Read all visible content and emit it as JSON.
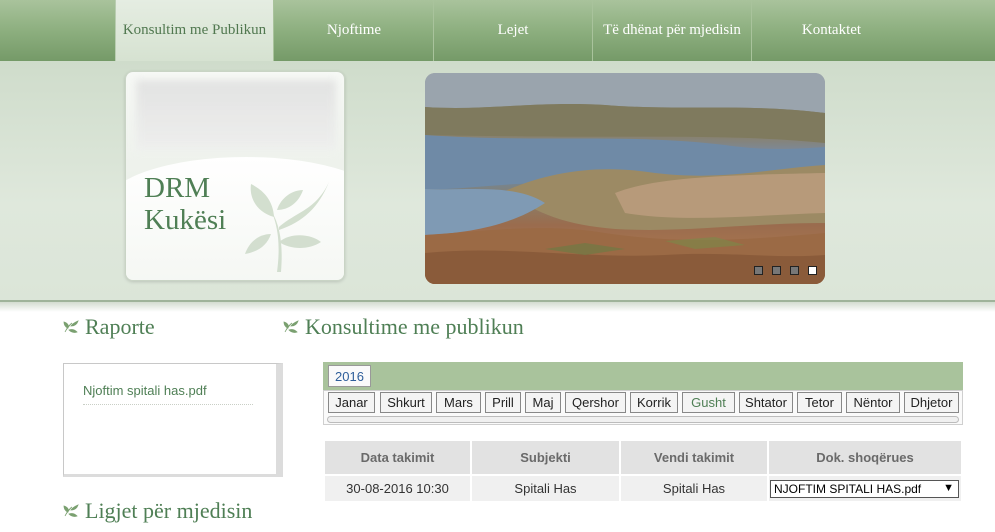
{
  "nav": {
    "items": [
      {
        "label": "Konsultim me Publikun",
        "active": true
      },
      {
        "label": "Njoftime",
        "active": false
      },
      {
        "label": "Lejet",
        "active": false
      },
      {
        "label": "Të dhënat për mjedisin",
        "active": false
      },
      {
        "label": "Kontaktet",
        "active": false
      }
    ]
  },
  "logo": {
    "line1": "DRM",
    "line2": "Kukësi",
    "icon": "plant-leaf-icon"
  },
  "slideshow": {
    "slides": 4,
    "active_slide": 4
  },
  "sidebar": {
    "reports_title": "Raporte",
    "reports": [
      "Njoftim spitali has.pdf"
    ],
    "laws_title": "Ligjet për mjedisin"
  },
  "main": {
    "title": "Konsultime me publikun",
    "year": "2016",
    "months": [
      "Janar",
      "Shkurt",
      "Mars",
      "Prill",
      "Maj",
      "Qershor",
      "Korrik",
      "Gusht",
      "Shtator",
      "Tetor",
      "Nëntor",
      "Dhjetor"
    ],
    "active_month": "Gusht",
    "table": {
      "headers": [
        "Data takimit",
        "Subjekti",
        "Vendi takimit",
        "Dok. shoqërues"
      ],
      "rows": [
        {
          "date": "30-08-2016 10:30",
          "subject": "Spitali Has",
          "venue": "Spitali Has",
          "document": "NJOFTIM SPITALI HAS.pdf"
        }
      ]
    }
  },
  "colors": {
    "accent": "#4f7f55",
    "nav": "#8daf7f",
    "band": "#dfe8dc"
  }
}
